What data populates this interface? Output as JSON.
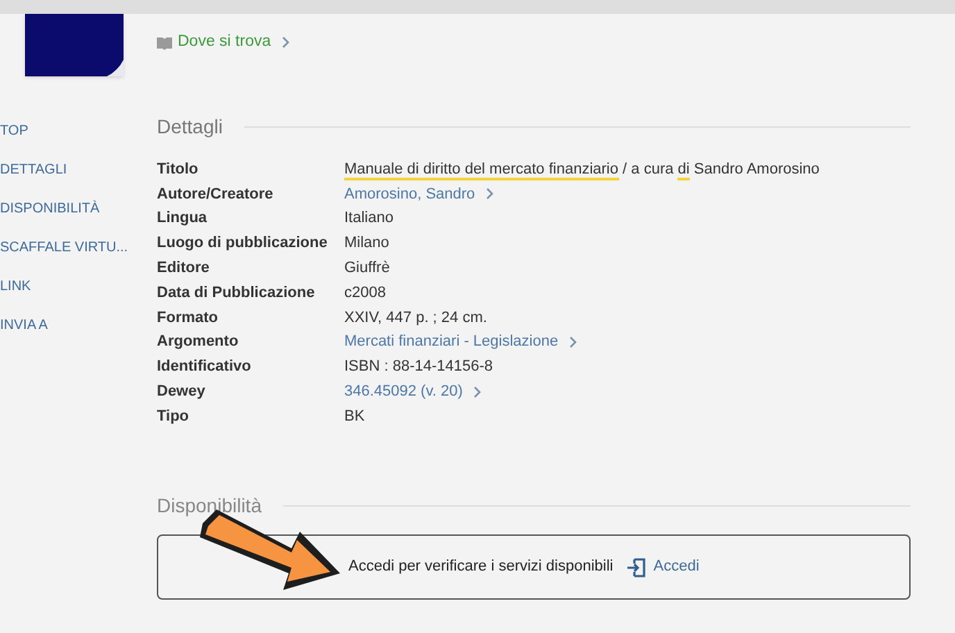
{
  "location_link": {
    "label": "Dove si trova"
  },
  "nav": [
    {
      "label": "TOP"
    },
    {
      "label": "DETTAGLI"
    },
    {
      "label": "DISPONIBILITÀ"
    },
    {
      "label": "SCAFFALE VIRTU..."
    },
    {
      "label": "LINK"
    },
    {
      "label": "INVIA A"
    }
  ],
  "details": {
    "heading": "Dettagli",
    "rows": [
      {
        "label": "Titolo",
        "kind": "segments",
        "segments": [
          {
            "text": "Manuale di diritto del mercato finanziario",
            "highlighted": true
          },
          {
            "text": " / a cura ",
            "highlighted": false
          },
          {
            "text": "di",
            "highlighted": true
          },
          {
            "text": " Sandro Amorosino",
            "highlighted": false
          }
        ]
      },
      {
        "label": "Autore/Creatore",
        "kind": "link",
        "value": "Amorosino, Sandro"
      },
      {
        "label": "Lingua",
        "kind": "text",
        "value": "Italiano"
      },
      {
        "label": "Luogo di pubblicazione",
        "kind": "text",
        "value": "Milano"
      },
      {
        "label": "Editore",
        "kind": "text",
        "value": "Giuffrè"
      },
      {
        "label": "Data di Pubblicazione",
        "kind": "text",
        "value": "c2008"
      },
      {
        "label": "Formato",
        "kind": "text",
        "value": "XXIV, 447 p. ; 24 cm."
      },
      {
        "label": "Argomento",
        "kind": "link",
        "value": "Mercati finanziari - Legislazione"
      },
      {
        "label": "Identificativo",
        "kind": "text",
        "value": "ISBN : 88-14-14156-8"
      },
      {
        "label": "Dewey",
        "kind": "link",
        "value": "346.45092 (v. 20)"
      },
      {
        "label": "Tipo",
        "kind": "text",
        "value": "BK"
      }
    ]
  },
  "availability": {
    "heading": "Disponibilità",
    "message": "Accedi per verificare i servizi disponibili",
    "button": "Accedi"
  }
}
